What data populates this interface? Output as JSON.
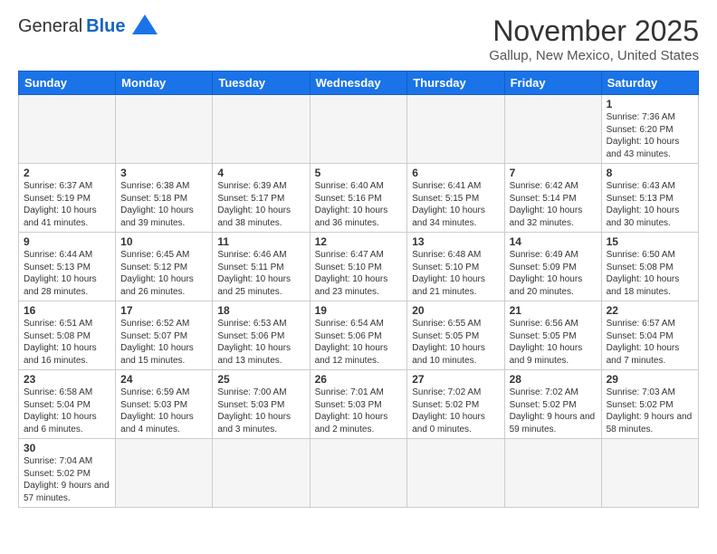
{
  "header": {
    "logo_general": "General",
    "logo_blue": "Blue",
    "title": "November 2025",
    "location": "Gallup, New Mexico, United States"
  },
  "days_of_week": [
    "Sunday",
    "Monday",
    "Tuesday",
    "Wednesday",
    "Thursday",
    "Friday",
    "Saturday"
  ],
  "weeks": [
    [
      {
        "day": "",
        "info": ""
      },
      {
        "day": "",
        "info": ""
      },
      {
        "day": "",
        "info": ""
      },
      {
        "day": "",
        "info": ""
      },
      {
        "day": "",
        "info": ""
      },
      {
        "day": "",
        "info": ""
      },
      {
        "day": "1",
        "info": "Sunrise: 7:36 AM\nSunset: 6:20 PM\nDaylight: 10 hours and 43 minutes."
      }
    ],
    [
      {
        "day": "2",
        "info": "Sunrise: 6:37 AM\nSunset: 5:19 PM\nDaylight: 10 hours and 41 minutes."
      },
      {
        "day": "3",
        "info": "Sunrise: 6:38 AM\nSunset: 5:18 PM\nDaylight: 10 hours and 39 minutes."
      },
      {
        "day": "4",
        "info": "Sunrise: 6:39 AM\nSunset: 5:17 PM\nDaylight: 10 hours and 38 minutes."
      },
      {
        "day": "5",
        "info": "Sunrise: 6:40 AM\nSunset: 5:16 PM\nDaylight: 10 hours and 36 minutes."
      },
      {
        "day": "6",
        "info": "Sunrise: 6:41 AM\nSunset: 5:15 PM\nDaylight: 10 hours and 34 minutes."
      },
      {
        "day": "7",
        "info": "Sunrise: 6:42 AM\nSunset: 5:14 PM\nDaylight: 10 hours and 32 minutes."
      },
      {
        "day": "8",
        "info": "Sunrise: 6:43 AM\nSunset: 5:13 PM\nDaylight: 10 hours and 30 minutes."
      }
    ],
    [
      {
        "day": "9",
        "info": "Sunrise: 6:44 AM\nSunset: 5:13 PM\nDaylight: 10 hours and 28 minutes."
      },
      {
        "day": "10",
        "info": "Sunrise: 6:45 AM\nSunset: 5:12 PM\nDaylight: 10 hours and 26 minutes."
      },
      {
        "day": "11",
        "info": "Sunrise: 6:46 AM\nSunset: 5:11 PM\nDaylight: 10 hours and 25 minutes."
      },
      {
        "day": "12",
        "info": "Sunrise: 6:47 AM\nSunset: 5:10 PM\nDaylight: 10 hours and 23 minutes."
      },
      {
        "day": "13",
        "info": "Sunrise: 6:48 AM\nSunset: 5:10 PM\nDaylight: 10 hours and 21 minutes."
      },
      {
        "day": "14",
        "info": "Sunrise: 6:49 AM\nSunset: 5:09 PM\nDaylight: 10 hours and 20 minutes."
      },
      {
        "day": "15",
        "info": "Sunrise: 6:50 AM\nSunset: 5:08 PM\nDaylight: 10 hours and 18 minutes."
      }
    ],
    [
      {
        "day": "16",
        "info": "Sunrise: 6:51 AM\nSunset: 5:08 PM\nDaylight: 10 hours and 16 minutes."
      },
      {
        "day": "17",
        "info": "Sunrise: 6:52 AM\nSunset: 5:07 PM\nDaylight: 10 hours and 15 minutes."
      },
      {
        "day": "18",
        "info": "Sunrise: 6:53 AM\nSunset: 5:06 PM\nDaylight: 10 hours and 13 minutes."
      },
      {
        "day": "19",
        "info": "Sunrise: 6:54 AM\nSunset: 5:06 PM\nDaylight: 10 hours and 12 minutes."
      },
      {
        "day": "20",
        "info": "Sunrise: 6:55 AM\nSunset: 5:05 PM\nDaylight: 10 hours and 10 minutes."
      },
      {
        "day": "21",
        "info": "Sunrise: 6:56 AM\nSunset: 5:05 PM\nDaylight: 10 hours and 9 minutes."
      },
      {
        "day": "22",
        "info": "Sunrise: 6:57 AM\nSunset: 5:04 PM\nDaylight: 10 hours and 7 minutes."
      }
    ],
    [
      {
        "day": "23",
        "info": "Sunrise: 6:58 AM\nSunset: 5:04 PM\nDaylight: 10 hours and 6 minutes."
      },
      {
        "day": "24",
        "info": "Sunrise: 6:59 AM\nSunset: 5:03 PM\nDaylight: 10 hours and 4 minutes."
      },
      {
        "day": "25",
        "info": "Sunrise: 7:00 AM\nSunset: 5:03 PM\nDaylight: 10 hours and 3 minutes."
      },
      {
        "day": "26",
        "info": "Sunrise: 7:01 AM\nSunset: 5:03 PM\nDaylight: 10 hours and 2 minutes."
      },
      {
        "day": "27",
        "info": "Sunrise: 7:02 AM\nSunset: 5:02 PM\nDaylight: 10 hours and 0 minutes."
      },
      {
        "day": "28",
        "info": "Sunrise: 7:02 AM\nSunset: 5:02 PM\nDaylight: 9 hours and 59 minutes."
      },
      {
        "day": "29",
        "info": "Sunrise: 7:03 AM\nSunset: 5:02 PM\nDaylight: 9 hours and 58 minutes."
      }
    ],
    [
      {
        "day": "30",
        "info": "Sunrise: 7:04 AM\nSunset: 5:02 PM\nDaylight: 9 hours and 57 minutes."
      },
      {
        "day": "",
        "info": ""
      },
      {
        "day": "",
        "info": ""
      },
      {
        "day": "",
        "info": ""
      },
      {
        "day": "",
        "info": ""
      },
      {
        "day": "",
        "info": ""
      },
      {
        "day": "",
        "info": ""
      }
    ]
  ]
}
